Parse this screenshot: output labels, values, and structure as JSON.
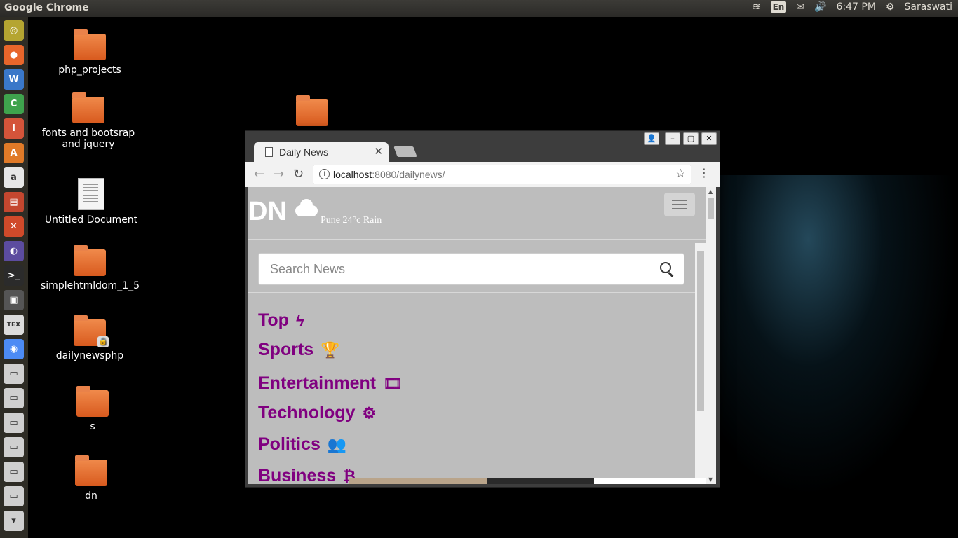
{
  "panel": {
    "app_title": "Google Chrome",
    "keyboard": "En",
    "time": "6:47 PM",
    "user": "Saraswati"
  },
  "launcher": [
    {
      "name": "ubuntu-dash-icon",
      "color": "#b5a531",
      "glyph": "◎"
    },
    {
      "name": "firefox-icon",
      "color": "#e8662b",
      "glyph": "●"
    },
    {
      "name": "libreoffice-writer-icon",
      "color": "#3a78c9",
      "glyph": "W"
    },
    {
      "name": "libreoffice-calc-icon",
      "color": "#3fa34d",
      "glyph": "C"
    },
    {
      "name": "libreoffice-impress-icon",
      "color": "#d4543a",
      "glyph": "I"
    },
    {
      "name": "software-center-icon",
      "color": "#e07a28",
      "glyph": "A"
    },
    {
      "name": "amazon-icon",
      "color": "#e6e6e6",
      "glyph": "a"
    },
    {
      "name": "app-icon",
      "color": "#c4472f",
      "glyph": "▤"
    },
    {
      "name": "settings-icon",
      "color": "#d04a2a",
      "glyph": "✕"
    },
    {
      "name": "eclipse-icon",
      "color": "#5c4c9f",
      "glyph": "◐"
    },
    {
      "name": "terminal-icon",
      "color": "#2b2b2b",
      "glyph": ">_"
    },
    {
      "name": "screenshot-icon",
      "color": "#555555",
      "glyph": "▣"
    },
    {
      "name": "tex-icon",
      "color": "#dcdcdc",
      "glyph": "TEX"
    },
    {
      "name": "chrome-icon",
      "color": "#4c8bf5",
      "glyph": "◉"
    },
    {
      "name": "drive-icon",
      "color": "#cfcfcf",
      "glyph": "▭"
    },
    {
      "name": "drive-icon",
      "color": "#cfcfcf",
      "glyph": "▭"
    },
    {
      "name": "drive-icon",
      "color": "#cfcfcf",
      "glyph": "▭"
    },
    {
      "name": "drive-icon",
      "color": "#cfcfcf",
      "glyph": "▭"
    },
    {
      "name": "drive-icon",
      "color": "#cfcfcf",
      "glyph": "▭"
    },
    {
      "name": "drive-icon",
      "color": "#cfcfcf",
      "glyph": "▭"
    },
    {
      "name": "trash-icon",
      "color": "#cfcfcf",
      "glyph": "▾"
    }
  ],
  "desktop": {
    "icons": [
      {
        "label": "php_projects",
        "type": "folder"
      },
      {
        "label": "fonts and bootsrap and jquery",
        "type": "folder"
      },
      {
        "label": "Untitled Document",
        "type": "document"
      },
      {
        "label": "simplehtmldom_1_5",
        "type": "folder"
      },
      {
        "label": "dailynewsphp",
        "type": "folder-locked"
      },
      {
        "label": "s",
        "type": "folder"
      },
      {
        "label": "dn",
        "type": "folder"
      },
      {
        "label": "",
        "type": "folder"
      }
    ]
  },
  "browser": {
    "tab_title": "Daily News",
    "url_host": "localhost",
    "url_rest": ":8080/dailynews/"
  },
  "site": {
    "brand": "DN",
    "weather": "Pune 24°c Rain",
    "search_placeholder": "Search News",
    "categories": [
      {
        "label": "Top",
        "icon": "bolt-icon",
        "glyph": "ϟ"
      },
      {
        "label": "Sports",
        "icon": "trophy-icon",
        "glyph": "🏆"
      },
      {
        "label": "Entertainment",
        "icon": "film-icon",
        "glyph": "🎞"
      },
      {
        "label": "Technology",
        "icon": "cogs-icon",
        "glyph": "⚙"
      },
      {
        "label": "Politics",
        "icon": "users-icon",
        "glyph": "👥"
      },
      {
        "label": "Business",
        "icon": "bitcoin-icon",
        "glyph": "₿"
      }
    ],
    "accent_color": "#800080"
  }
}
